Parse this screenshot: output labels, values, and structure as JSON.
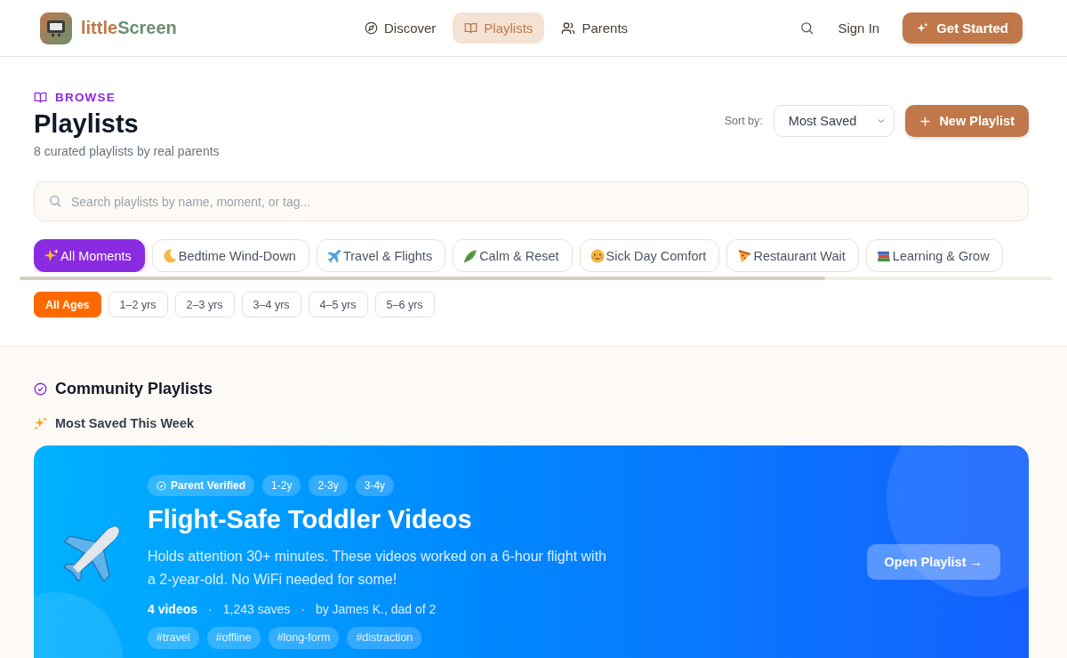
{
  "brand": {
    "part_1": "little",
    "part_2": "Screen"
  },
  "nav": [
    {
      "label": "Discover",
      "kind": "compass",
      "selected": false
    },
    {
      "label": "Playlists",
      "kind": "book",
      "selected": true
    },
    {
      "label": "Parents",
      "kind": "users",
      "selected": false
    }
  ],
  "header_actions": {
    "sign_in": "Sign In",
    "get_started": "Get Started"
  },
  "intro": {
    "eyebrow": "BROWSE",
    "title": "Playlists",
    "subtitle": "8 curated playlists by real parents",
    "sort_label": "Sort by:",
    "sort_value": "Most Saved",
    "new_button": "New Playlist"
  },
  "search": {
    "placeholder": "Search playlists by name, moment, or tag..."
  },
  "moments": [
    {
      "label": "All Moments",
      "kind": "sparkles",
      "selected": true
    },
    {
      "label": "Bedtime Wind-Down",
      "kind": "moon",
      "selected": false
    },
    {
      "label": "Travel & Flights",
      "kind": "plane",
      "selected": false
    },
    {
      "label": "Calm & Reset",
      "kind": "leaf",
      "selected": false
    },
    {
      "label": "Sick Day Comfort",
      "kind": "sick",
      "selected": false
    },
    {
      "label": "Restaurant Wait",
      "kind": "pizza",
      "selected": false
    },
    {
      "label": "Learning & Grow",
      "kind": "books",
      "selected": false
    }
  ],
  "ages": [
    {
      "label": "All Ages",
      "selected": true
    },
    {
      "label": "1–2 yrs",
      "selected": false
    },
    {
      "label": "2–3 yrs",
      "selected": false
    },
    {
      "label": "3–4 yrs",
      "selected": false
    },
    {
      "label": "4–5 yrs",
      "selected": false
    },
    {
      "label": "5–6 yrs",
      "selected": false
    }
  ],
  "community": {
    "title": "Community Playlists",
    "subtitle": "Most Saved This Week"
  },
  "featured": {
    "badges": [
      {
        "label": "Parent Verified",
        "kind": "verified"
      },
      {
        "label": "1-2y",
        "kind": "age"
      },
      {
        "label": "2-3y",
        "kind": "age"
      },
      {
        "label": "3-4y",
        "kind": "age"
      }
    ],
    "title": "Flight-Safe Toddler Videos",
    "description": "Holds attention 30+ minutes. These videos worked on a 6-hour flight with a 2-year-old. No WiFi needed for some!",
    "videos": "4 videos",
    "separator": "·",
    "saves": "1,243 saves",
    "author": "by James K., dad of 2",
    "tags": [
      "#travel",
      "#offline",
      "#long-form",
      "#distraction"
    ],
    "button": "Open Playlist →"
  }
}
